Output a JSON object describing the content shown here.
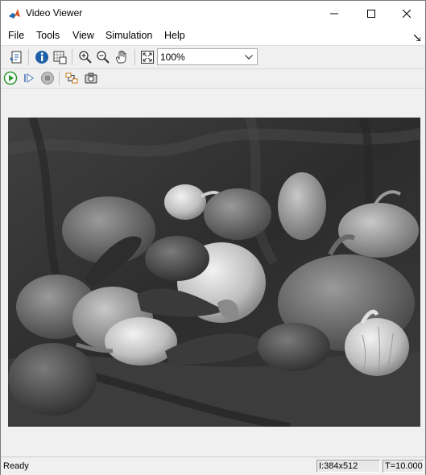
{
  "window": {
    "title": "Video Viewer"
  },
  "menu": [
    "File",
    "Tools",
    "View",
    "Simulation",
    "Help"
  ],
  "toolbar": {
    "zoom_value": "100%"
  },
  "status": {
    "state": "Ready",
    "image_size": "I:384x512",
    "time": "T=10.000"
  },
  "icons": {
    "app": "matlab-logo-icon",
    "colors": {
      "play_green": "#2e9a2e",
      "info_blue": "#1f5fa8",
      "stop_gray": "#8a8a8a"
    }
  }
}
